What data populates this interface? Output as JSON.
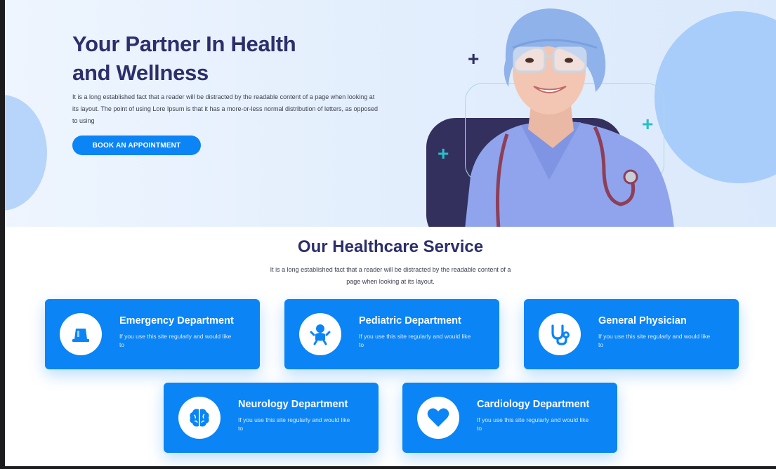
{
  "hero": {
    "title_line1": "Your Partner In Health",
    "title_line2": "and Wellness",
    "description": "It is a long established fact that a reader will be distracted by the readable content of a page when looking at its layout. The point of using Lore Ipsum is that it has a more-or-less normal distribution of letters, as opposed to using",
    "cta_label": "BOOK AN APPOINTMENT",
    "image_icon": "doctor-photo",
    "decor_icons": [
      "plus-icon",
      "plus-icon",
      "plus-icon"
    ]
  },
  "services": {
    "title": "Our Healthcare Service",
    "subtitle": "It is a long established fact that a reader will be distracted by the readable content of a page when looking at its layout.",
    "items": [
      {
        "title": "Emergency Department",
        "text": "If you use this site regularly and would like to",
        "icon": "emergency-light-icon"
      },
      {
        "title": "Pediatric Department",
        "text": "If you use this site regularly and would like to",
        "icon": "baby-icon"
      },
      {
        "title": "General Physician",
        "text": "If you use this site regularly and would like to",
        "icon": "stethoscope-icon"
      },
      {
        "title": "Neurology Department",
        "text": "If you use this site regularly and would like to",
        "icon": "brain-icon"
      },
      {
        "title": "Cardiology Department",
        "text": "If you use this site regularly and would like to",
        "icon": "heart-icon"
      }
    ]
  },
  "colors": {
    "accent": "#0b84f5",
    "heading": "#2c2f6b",
    "teal": "#26c0c6",
    "dark_shape": "#33305e"
  }
}
